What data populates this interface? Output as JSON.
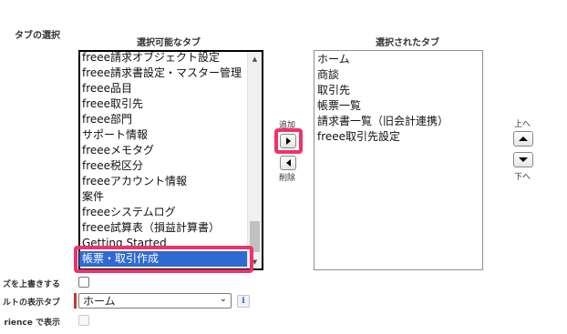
{
  "section_label": "タブの選択",
  "available": {
    "title": "選択可能なタブ",
    "items": [
      "freee請求オブジェクト設定",
      "freee請求書設定・マスター管理",
      "freee品目",
      "freee取引先",
      "freee部門",
      "サポート情報",
      "freeeメモタグ",
      "freee税区分",
      "freeeアカウント情報",
      "案件",
      "freeeシステムログ",
      "freee試算表（損益計算書）",
      "Getting Started",
      "帳票・取引作成"
    ],
    "selected_item": "帳票・取引作成"
  },
  "selected": {
    "title": "選択されたタブ",
    "items": [
      "ホーム",
      "商談",
      "取引先",
      "帳票一覧",
      "請求書一覧（旧会計連携）",
      "freee取引先設定"
    ]
  },
  "buttons": {
    "add_label": "追加",
    "remove_label": "削除",
    "up_label": "上へ",
    "down_label": "下へ"
  },
  "form": {
    "overwrite_label": "ズを上書きする",
    "default_tab_label": "ルトの表示タブ",
    "default_tab_value": "ホーム",
    "experience_label": "rience で表示"
  },
  "colors": {
    "highlight": "#f0316b",
    "selection": "#2e6ad1",
    "required_marker": "#c23934"
  },
  "icons": {
    "info": "i"
  }
}
